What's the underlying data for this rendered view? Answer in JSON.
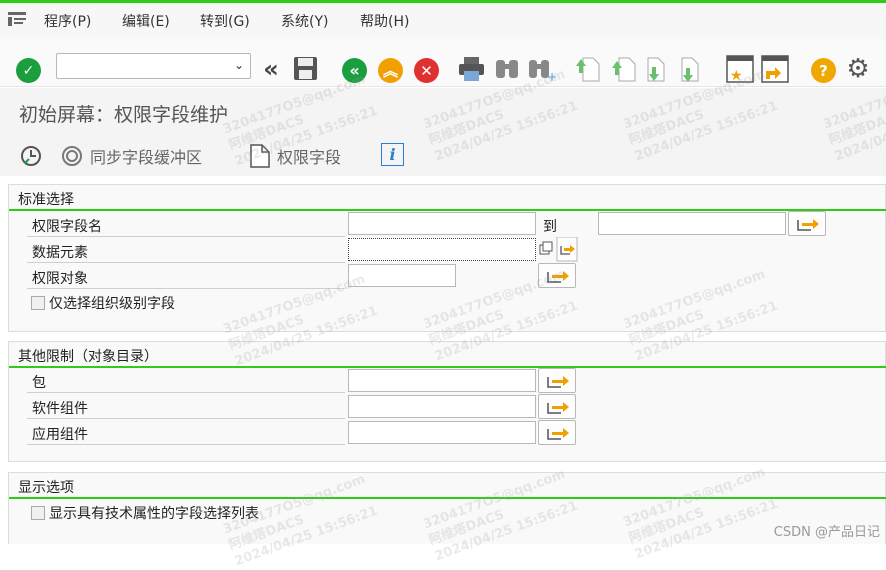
{
  "menu": {
    "items": [
      "程序(P)",
      "编辑(E)",
      "转到(G)",
      "系统(Y)",
      "帮助(H)"
    ]
  },
  "toolbar": {
    "command_field_value": "",
    "icons": [
      "confirm-icon",
      "back-double-icon",
      "save-icon",
      "back-icon",
      "exit-icon",
      "cancel-icon",
      "print-icon",
      "find-icon",
      "find-next-icon",
      "first-page-icon",
      "previous-page-icon",
      "next-page-icon",
      "last-page-icon",
      "create-session-icon",
      "generate-shortcut-icon",
      "help-icon",
      "settings-icon"
    ]
  },
  "title": "初始屏幕：权限字段维护",
  "app_toolbar": {
    "sync_label": "同步字段缓冲区",
    "auth_field_label": "权限字段"
  },
  "sections": {
    "standard": {
      "title": "标准选择",
      "auth_field_name": "权限字段名",
      "to_label": "到",
      "data_element": "数据元素",
      "auth_object": "权限对象",
      "org_level_only": "仅选择组织级别字段"
    },
    "other": {
      "title": "其他限制（对象目录）",
      "package": "包",
      "software_component": "软件组件",
      "application_component": "应用组件"
    },
    "display": {
      "title": "显示选项",
      "show_tech_attrs": "显示具有技术属性的字段选择列表"
    }
  },
  "watermark": {
    "line1": "3204177O5@qq.com",
    "line2": "阿维塔DACS",
    "line3": "2024/04/25 15:56:21"
  },
  "footer_credit": "CSDN @产品日记",
  "colors": {
    "accent_green": "#2ecc17",
    "confirm_green": "#1b9e3e",
    "nav_orange": "#f0a000",
    "cancel_red": "#e03030",
    "help_orange": "#f0a800"
  }
}
